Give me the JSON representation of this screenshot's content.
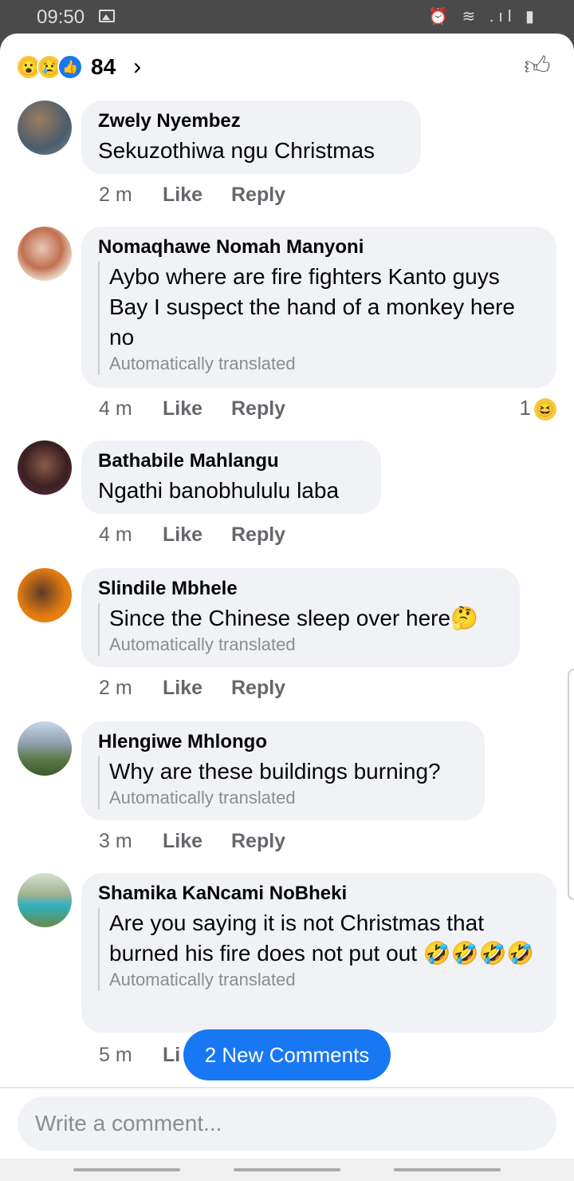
{
  "status": {
    "time": "09:50",
    "system_icons": "⏰ ≋ .ıl ▮"
  },
  "reactions": {
    "count": "84",
    "icons": [
      "wow-emoji",
      "sad-emoji",
      "like-icon"
    ]
  },
  "comments": [
    {
      "name": "Zwely Nyembez",
      "text": "Sekuzothiwa ngu Christmas",
      "time": "2 m",
      "like": "Like",
      "reply": "Reply"
    },
    {
      "name": "Nomaqhawe Nomah Manyoni",
      "text": "Aybo where are fire fighters Kanto guys Bay I suspect the hand of a monkey here no",
      "translated": "Automatically translated",
      "time": "4 m",
      "like": "Like",
      "reply": "Reply",
      "reaction_count": "1"
    },
    {
      "name": "Bathabile Mahlangu",
      "text": "Ngathi banobhululu laba",
      "time": "4 m",
      "like": "Like",
      "reply": "Reply"
    },
    {
      "name": "Slindile Mbhele",
      "text": "Since the Chinese sleep over here🤔",
      "translated": "Automatically translated",
      "time": "2 m",
      "like": "Like",
      "reply": "Reply"
    },
    {
      "name": "Hlengiwe Mhlongo",
      "text": "Why are these buildings burning?",
      "translated": "Automatically translated",
      "time": "3 m",
      "like": "Like",
      "reply": "Reply"
    },
    {
      "name": "Shamika KaNcami NoBheki",
      "text": "Are you saying it is not Christmas that burned his fire does not put out 🤣🤣🤣🤣",
      "translated": "Automatically translated",
      "time": "5 m",
      "like": "Li"
    }
  ],
  "new_comments_button": "2 New Comments",
  "composer": {
    "placeholder": "Write a comment..."
  },
  "colors": {
    "accent": "#1877f2",
    "bubble": "#f0f2f5"
  }
}
